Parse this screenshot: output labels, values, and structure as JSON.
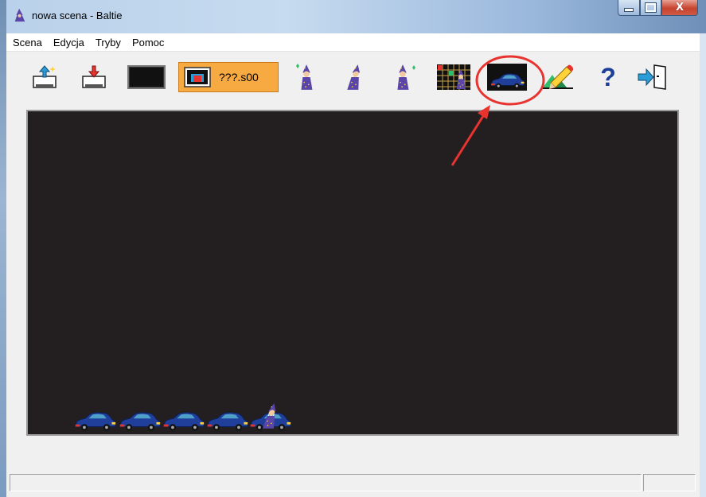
{
  "window": {
    "title": "nowa scena - Baltie",
    "controls": {
      "minimize": "–",
      "maximize": "□",
      "close": "X"
    }
  },
  "menubar": {
    "items": [
      {
        "label": "Scena"
      },
      {
        "label": "Edycja"
      },
      {
        "label": "Tryby"
      },
      {
        "label": "Pomoc"
      }
    ]
  },
  "toolbar": {
    "buttons": [
      {
        "name": "open-scene",
        "icon": "open-scene-icon"
      },
      {
        "name": "save-scene",
        "icon": "save-scene-icon"
      },
      {
        "name": "black-screen",
        "icon": "black-screen-icon"
      },
      {
        "name": "scene-file",
        "icon": "scene-file-icon",
        "label": "???.s00",
        "color": "#f7a942"
      },
      {
        "name": "wizard-appear",
        "icon": "wizard-appear-icon"
      },
      {
        "name": "wizard-walk",
        "icon": "wizard-walk-icon"
      },
      {
        "name": "wizard-disappear",
        "icon": "wizard-disappear-icon"
      },
      {
        "name": "grid-view",
        "icon": "grid-wizard-icon"
      },
      {
        "name": "car-item",
        "icon": "car-icon",
        "highlighted": true
      },
      {
        "name": "draw-pencil",
        "icon": "pencil-icon"
      },
      {
        "name": "help",
        "icon": "question-mark-icon",
        "label": "?"
      },
      {
        "name": "exit",
        "icon": "exit-door-icon"
      }
    ]
  },
  "scene": {
    "background": "#231f20",
    "objects": [
      {
        "type": "car",
        "icon": "car-icon"
      },
      {
        "type": "car",
        "icon": "car-icon"
      },
      {
        "type": "car",
        "icon": "car-icon"
      },
      {
        "type": "car",
        "icon": "car-icon"
      },
      {
        "type": "wizard-on-car",
        "icon": "wizard-icon"
      }
    ]
  },
  "annotation": {
    "circle_color": "#e8332f",
    "arrow_color": "#e8332f"
  },
  "colors": {
    "car_body": "#1f3f9a",
    "car_window": "#4fa0c8",
    "wizard_robe": "#5a46a8",
    "accent_orange": "#f7a942"
  }
}
